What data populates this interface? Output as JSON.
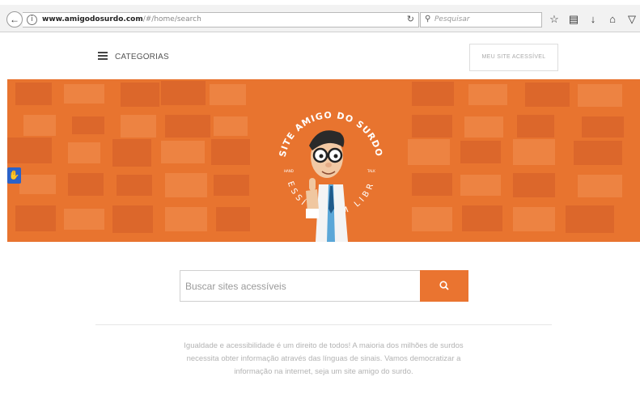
{
  "browser": {
    "url_domain": "www.amigodosurdo.com",
    "url_path": "/#/home/search",
    "search_placeholder": "Pesquisar"
  },
  "header": {
    "menu_label": "CATEGORIAS",
    "my_site_button": "MEU SITE ACESSÍVEL"
  },
  "hero": {
    "logo_text_top": "SITE AMIGO DO SURDO",
    "logo_text_bottom": "ACESSÍVEL EM LIBRAS",
    "logo_small_left": "HAND",
    "logo_small_right": "TALK",
    "brand_color": "#e8742f"
  },
  "search": {
    "placeholder": "Buscar sites acessíveis",
    "button_color": "#ea7430"
  },
  "tagline": {
    "line1": "Igualdade e acessibilidade é um direito de todos! A maioria dos milhões de surdos",
    "line2": "necessita obter informação através das línguas de sinais. Vamos democratizar a",
    "line3": "informação na internet, seja um site amigo do surdo."
  }
}
